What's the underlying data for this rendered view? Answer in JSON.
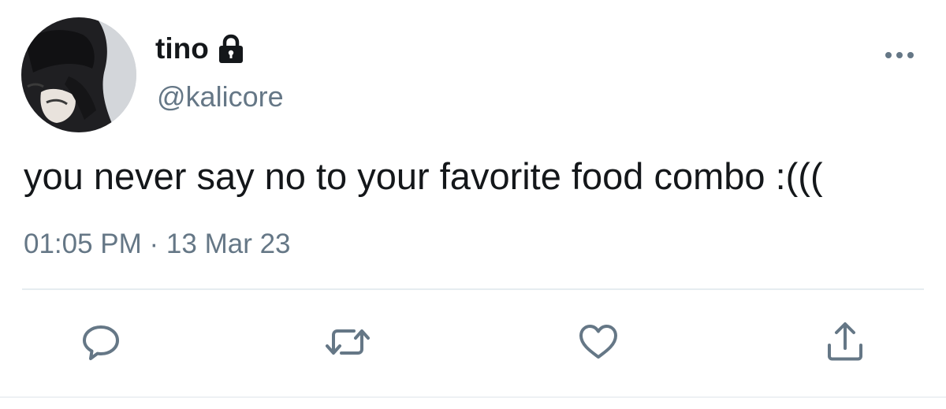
{
  "tweet": {
    "display_name": "tino",
    "handle": "@kalicore",
    "text": "you never say no to your favorite food combo :(((",
    "timestamp": "01:05 PM · 13 Mar 23",
    "protected_icon": "lock-icon",
    "more_icon": "more-dots-icon"
  },
  "actions": {
    "reply_icon": "reply-icon",
    "retweet_icon": "retweet-icon",
    "like_icon": "heart-icon",
    "share_icon": "share-icon"
  },
  "colors": {
    "primary_text": "#14171a",
    "secondary_text": "#657786",
    "divider": "#e6ecf0"
  }
}
